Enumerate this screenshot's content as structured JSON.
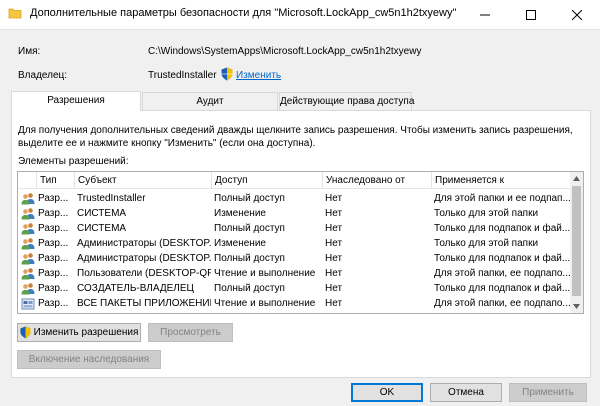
{
  "window": {
    "title": "Дополнительные параметры безопасности  для \"Microsoft.LockApp_cw5n1h2txyewy\"",
    "minimize": "—",
    "maximize": "☐",
    "close": "✕"
  },
  "info": {
    "name_label": "Имя:",
    "name_value": "C:\\Windows\\SystemApps\\Microsoft.LockApp_cw5n1h2txyewy",
    "owner_label": "Владелец:",
    "owner_value": "TrustedInstaller",
    "change_link": "Изменить"
  },
  "tabs": [
    {
      "label": "Разрешения"
    },
    {
      "label": "Аудит"
    },
    {
      "label": "Действующие права доступа"
    }
  ],
  "description": "Для получения дополнительных сведений дважды щелкните запись разрешения. Чтобы изменить запись разрешения, выделите ее и нажмите кнопку \"Изменить\" (если она доступна).",
  "elements_label": "Элементы разрешений:",
  "table": {
    "columns": [
      "Тип",
      "Субъект",
      "Доступ",
      "Унаследовано от",
      "Применяется к"
    ],
    "rows": [
      {
        "icon": "users-icon",
        "type": "Разр...",
        "subject": "TrustedInstaller",
        "access": "Полный доступ",
        "inherited": "Нет",
        "applies": "Для этой папки и ее подпап..."
      },
      {
        "icon": "users-icon",
        "type": "Разр...",
        "subject": "СИСТЕМА",
        "access": "Изменение",
        "inherited": "Нет",
        "applies": "Только для этой папки"
      },
      {
        "icon": "users-icon",
        "type": "Разр...",
        "subject": "СИСТЕМА",
        "access": "Полный доступ",
        "inherited": "Нет",
        "applies": "Только для подпапок и фай..."
      },
      {
        "icon": "users-icon",
        "type": "Разр...",
        "subject": "Администраторы (DESKTOP...",
        "access": "Изменение",
        "inherited": "Нет",
        "applies": "Только для этой папки"
      },
      {
        "icon": "users-icon",
        "type": "Разр...",
        "subject": "Администраторы (DESKTOP...",
        "access": "Полный доступ",
        "inherited": "Нет",
        "applies": "Только для подпапок и фай..."
      },
      {
        "icon": "users-icon",
        "type": "Разр...",
        "subject": "Пользователи (DESKTOP-QF...",
        "access": "Чтение и выполнение",
        "inherited": "Нет",
        "applies": "Для этой папки, ее подпапо..."
      },
      {
        "icon": "users-icon",
        "type": "Разр...",
        "subject": "СОЗДАТЕЛЬ-ВЛАДЕЛЕЦ",
        "access": "Полный доступ",
        "inherited": "Нет",
        "applies": "Только для подпапок и фай..."
      },
      {
        "icon": "package-icon",
        "type": "Разр...",
        "subject": "ВСЕ ПАКЕТЫ ПРИЛОЖЕНИЙ",
        "access": "Чтение и выполнение",
        "inherited": "Нет",
        "applies": "Для этой папки, ее подпапо..."
      }
    ]
  },
  "buttons": {
    "change_permissions": "Изменить разрешения",
    "view": "Просмотреть",
    "enable_inheritance": "Включение наследования",
    "ok": "OK",
    "cancel": "Отмена",
    "apply": "Применить"
  },
  "colors": {
    "link": "#0066cc",
    "accent": "#0078d7"
  }
}
